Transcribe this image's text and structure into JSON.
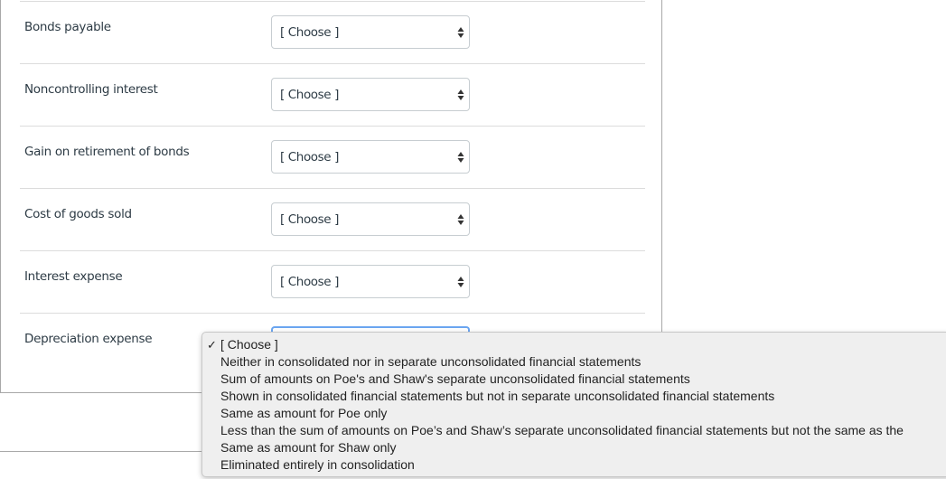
{
  "form": {
    "rows": [
      {
        "label": "Bonds payable",
        "selected": "[ Choose ]"
      },
      {
        "label": "Noncontrolling interest",
        "selected": "[ Choose ]"
      },
      {
        "label": "Gain on retirement of bonds",
        "selected": "[ Choose ]"
      },
      {
        "label": "Cost of goods sold",
        "selected": "[ Choose ]"
      },
      {
        "label": "Interest expense",
        "selected": "[ Choose ]"
      },
      {
        "label": "Depreciation expense",
        "selected": "[ Choose ]"
      }
    ]
  },
  "dropdown": {
    "checkmark": "✓",
    "options": [
      "[ Choose ]",
      "Neither in consolidated nor in separate unconsolidated financial statements",
      "Sum of amounts on Poe's and Shaw's separate unconsolidated financial statements",
      "Shown in consolidated financial statements but not in separate unconsolidated financial statements",
      "Same as amount for Poe only",
      "Less than the sum of amounts on Poe’s and Shaw’s separate unconsolidated financial statements but not the same as the",
      "Same as amount for Shaw only",
      "Eliminated entirely in consolidation"
    ]
  },
  "colors": {
    "focus_border": "#6aa5f0",
    "text": "#2d3b45",
    "dropdown_bg": "#efefef"
  }
}
